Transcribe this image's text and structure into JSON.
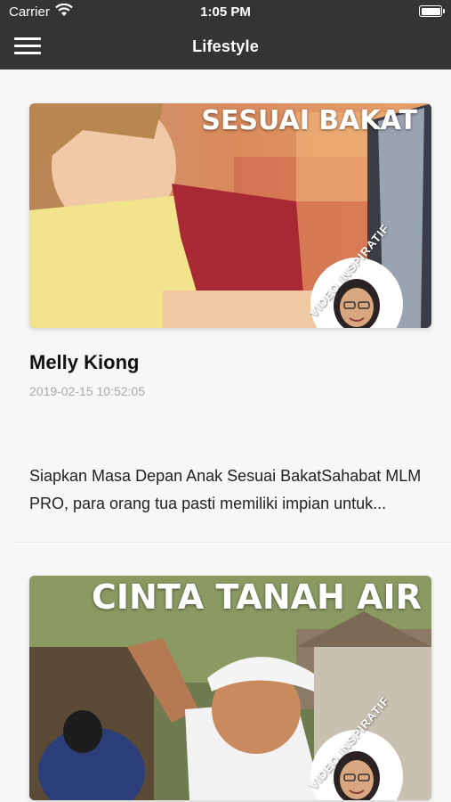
{
  "status_bar": {
    "carrier": "Carrier",
    "time": "1:05 PM"
  },
  "nav": {
    "title": "Lifestyle",
    "menu_icon": "hamburger-menu-icon"
  },
  "posts": [
    {
      "thumb_title": "SESUAI BAKAT",
      "thumb_badge": "VIDEO INSPIRATIF",
      "author": "Melly Kiong",
      "date": "2019-02-15 10:52:05",
      "excerpt": "Siapkan Masa Depan Anak Sesuai BakatSahabat MLM PRO, para orang tua pasti memiliki impian untuk..."
    },
    {
      "thumb_title": "CINTA TANAH AIR",
      "thumb_badge": "VIDEO INSPIRATIF"
    }
  ]
}
